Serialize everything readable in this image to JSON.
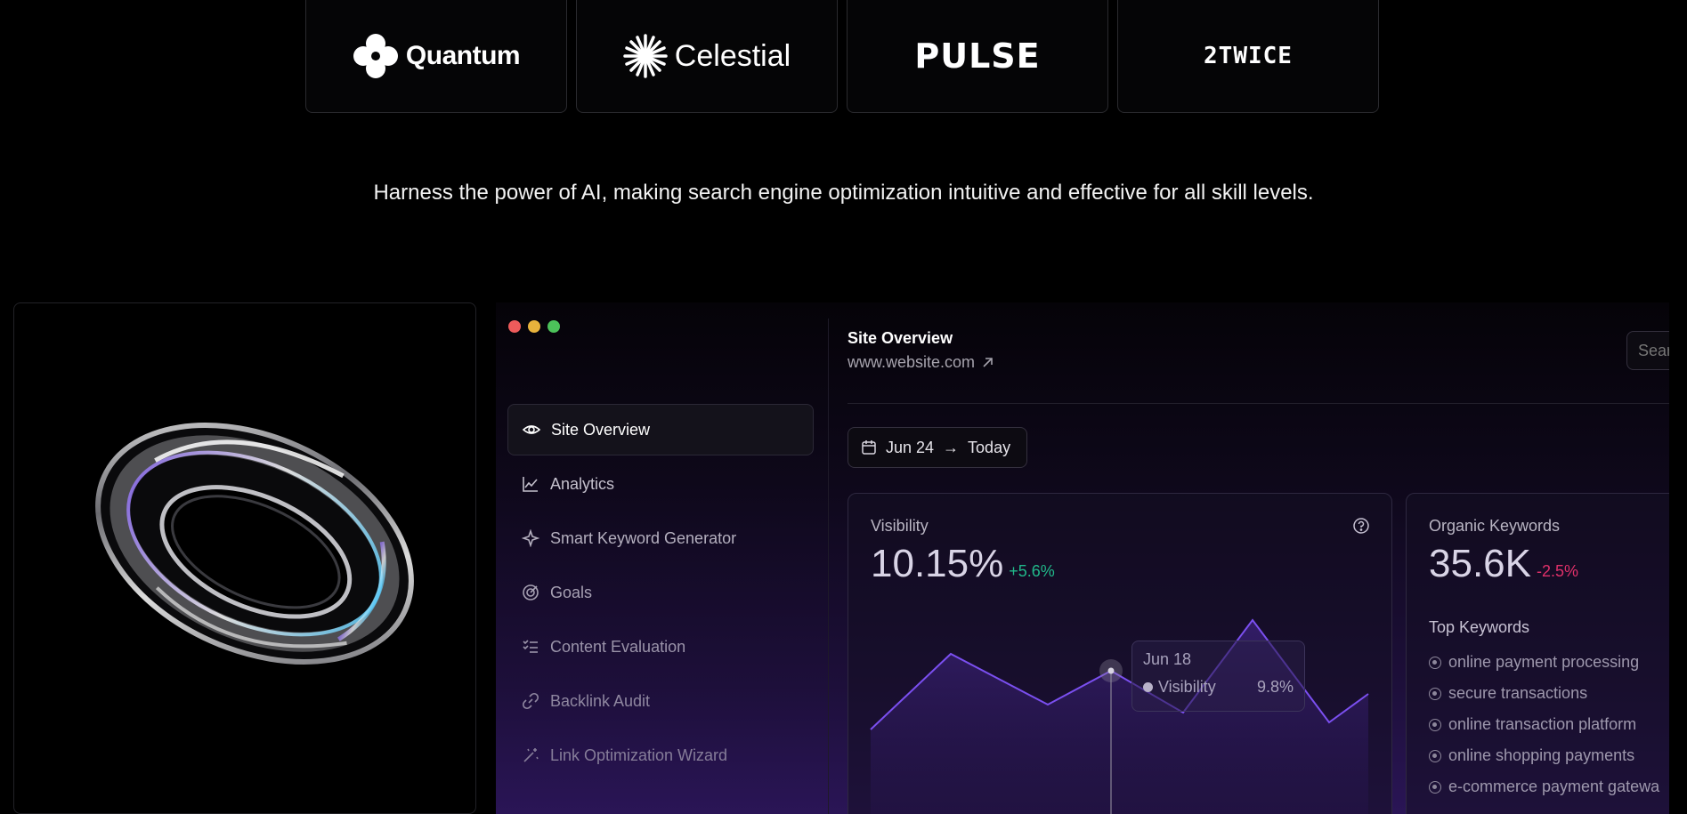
{
  "logos": [
    {
      "name": "Quantum"
    },
    {
      "name": "Celestial"
    },
    {
      "name": "PULSE"
    },
    {
      "name": "2TWICE"
    }
  ],
  "tagline": "Harness the power of AI, making search engine optimization intuitive and effective for all skill levels.",
  "window_dots": {
    "red": "#ee5b5b",
    "yellow": "#e8b33c",
    "green": "#4cc25a"
  },
  "sidebar": {
    "items": [
      {
        "label": "Site Overview",
        "icon": "eye-icon",
        "active": true
      },
      {
        "label": "Analytics",
        "icon": "line-chart-icon"
      },
      {
        "label": "Smart Keyword Generator",
        "icon": "sparkle-icon"
      },
      {
        "label": "Goals",
        "icon": "target-icon"
      },
      {
        "label": "Content Evaluation",
        "icon": "checklist-icon"
      },
      {
        "label": "Backlink Audit",
        "icon": "link-icon"
      },
      {
        "label": "Link Optimization Wizard",
        "icon": "magic-wand-icon"
      }
    ]
  },
  "header": {
    "title": "Site Overview",
    "url": "www.website.com",
    "search_placeholder": "Search"
  },
  "date_range": {
    "start": "Jun 24",
    "arrow": "→",
    "end": "Today"
  },
  "visibility": {
    "label": "Visibility",
    "value": "10.15%",
    "change": "+5.6%",
    "tooltip": {
      "date": "Jun 18",
      "series": "Visibility",
      "value": "9.8%"
    }
  },
  "organic_keywords": {
    "label": "Organic Keywords",
    "value": "35.6K",
    "change": "-2.5%",
    "list_title": "Top Keywords",
    "items": [
      "online payment processing",
      "secure transactions",
      "online transaction platform",
      "online shopping payments",
      "e-commerce payment gatewa"
    ]
  },
  "colors": {
    "accent": "#7b4ff0",
    "positive": "#21b98a",
    "negative": "#e0306a"
  }
}
